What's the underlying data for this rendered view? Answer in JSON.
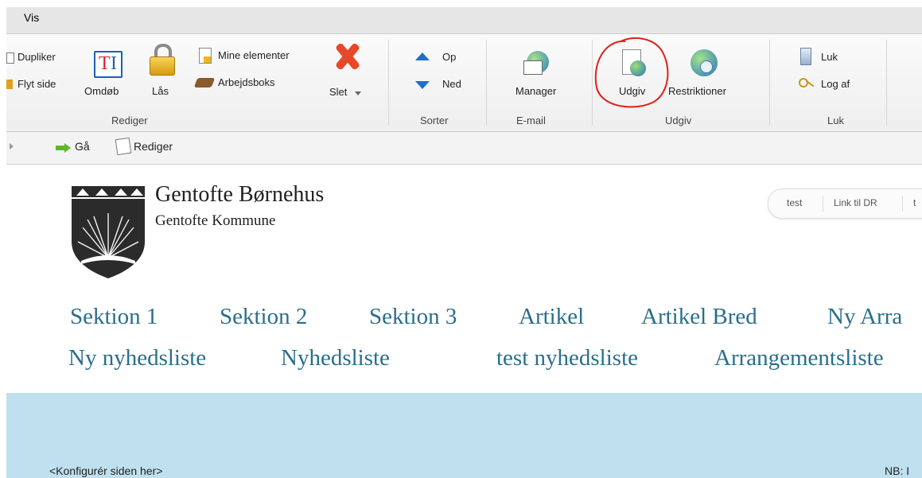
{
  "menubar": {
    "tab": "Vis"
  },
  "ribbon": {
    "rediger": {
      "duplicate": "Dupliker",
      "move_page": "Flyt side",
      "rename": "Omdøb",
      "lock": "Lås",
      "my_items": "Mine elementer",
      "workbox": "Arbejdsboks",
      "delete": "Slet",
      "group": "Rediger"
    },
    "sorter": {
      "up": "Op",
      "down": "Ned",
      "group": "Sorter"
    },
    "email": {
      "manager": "Manager",
      "group": "E-mail"
    },
    "udgiv": {
      "publish": "Udgiv",
      "restrictions": "Restriktioner",
      "group": "Udgiv"
    },
    "luk": {
      "close": "Luk",
      "logout": "Log af",
      "group": "Luk"
    }
  },
  "addressbar": {
    "go": "Gå",
    "edit": "Rediger"
  },
  "site": {
    "name": "Gentofte Børnehus",
    "subtitle": "Gentofte Kommune",
    "toplinks": [
      "test",
      "Link til DR",
      "t"
    ]
  },
  "nav": {
    "row1": [
      "Sektion 1",
      "Sektion 2",
      "Sektion 3",
      "Artikel",
      "Artikel Bred",
      "Ny Arra"
    ],
    "row2": [
      "Ny nyhedsliste",
      "Nyhedsliste",
      "test nyhedsliste",
      "Arrangementsliste"
    ]
  },
  "content": {
    "configure": "<Konfigurér siden her>",
    "note": "NB: I"
  },
  "colors": {
    "nav_link": "#2a6e8c",
    "band": "#bfe0ef",
    "annotation": "#e0201a"
  }
}
